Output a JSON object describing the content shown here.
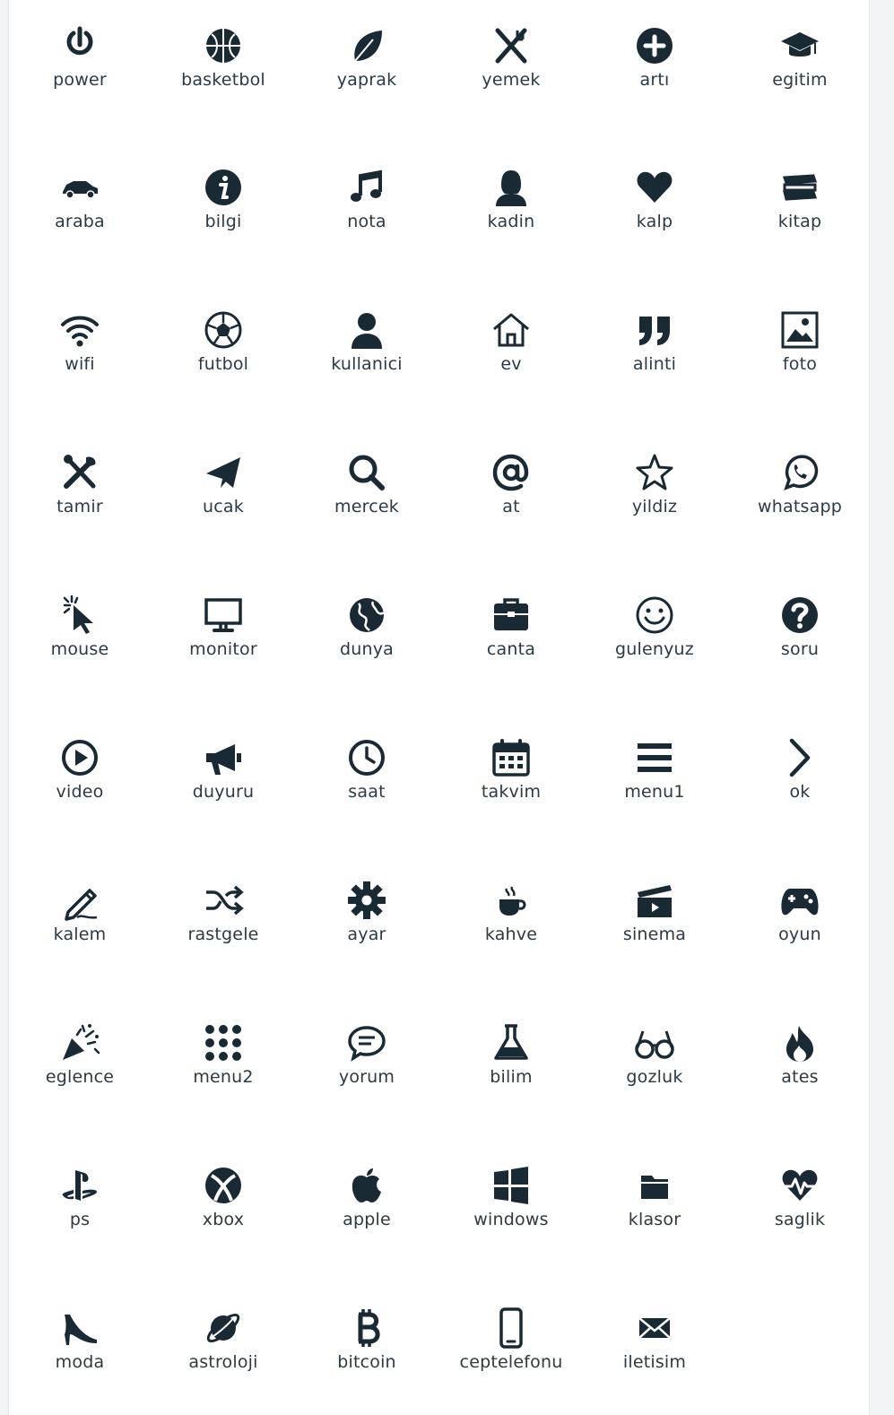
{
  "colors": {
    "icon": "#1a2a35",
    "label": "#2b3a44",
    "background": "#ffffff"
  },
  "icons": [
    {
      "label": "power",
      "icon": "power-icon"
    },
    {
      "label": "basketbol",
      "icon": "basketball-icon"
    },
    {
      "label": "yaprak",
      "icon": "leaf-icon"
    },
    {
      "label": "yemek",
      "icon": "utensils-icon"
    },
    {
      "label": "artı",
      "icon": "plus-circle-icon"
    },
    {
      "label": "egitim",
      "icon": "graduation-cap-icon"
    },
    {
      "label": "araba",
      "icon": "car-icon"
    },
    {
      "label": "bilgi",
      "icon": "info-icon"
    },
    {
      "label": "nota",
      "icon": "music-note-icon"
    },
    {
      "label": "kadin",
      "icon": "woman-icon"
    },
    {
      "label": "kalp",
      "icon": "heart-icon"
    },
    {
      "label": "kitap",
      "icon": "books-icon"
    },
    {
      "label": "wifi",
      "icon": "wifi-icon"
    },
    {
      "label": "futbol",
      "icon": "soccer-ball-icon"
    },
    {
      "label": "kullanici",
      "icon": "user-icon"
    },
    {
      "label": "ev",
      "icon": "home-icon"
    },
    {
      "label": "alinti",
      "icon": "quote-icon"
    },
    {
      "label": "foto",
      "icon": "photo-icon"
    },
    {
      "label": "tamir",
      "icon": "tools-icon"
    },
    {
      "label": "ucak",
      "icon": "paper-plane-icon"
    },
    {
      "label": "mercek",
      "icon": "search-icon"
    },
    {
      "label": "at",
      "icon": "at-sign-icon"
    },
    {
      "label": "yildiz",
      "icon": "star-icon"
    },
    {
      "label": "whatsapp",
      "icon": "whatsapp-icon"
    },
    {
      "label": "mouse",
      "icon": "cursor-icon"
    },
    {
      "label": "monitor",
      "icon": "monitor-icon"
    },
    {
      "label": "dunya",
      "icon": "globe-icon"
    },
    {
      "label": "canta",
      "icon": "briefcase-icon"
    },
    {
      "label": "gulenyuz",
      "icon": "smiley-icon"
    },
    {
      "label": "soru",
      "icon": "question-icon"
    },
    {
      "label": "video",
      "icon": "play-circle-icon"
    },
    {
      "label": "duyuru",
      "icon": "megaphone-icon"
    },
    {
      "label": "saat",
      "icon": "clock-icon"
    },
    {
      "label": "takvim",
      "icon": "calendar-icon"
    },
    {
      "label": "menu1",
      "icon": "hamburger-icon"
    },
    {
      "label": "ok",
      "icon": "chevron-right-icon"
    },
    {
      "label": "kalem",
      "icon": "pencil-icon"
    },
    {
      "label": "rastgele",
      "icon": "shuffle-icon"
    },
    {
      "label": "ayar",
      "icon": "gear-icon"
    },
    {
      "label": "kahve",
      "icon": "coffee-icon"
    },
    {
      "label": "sinema",
      "icon": "clapperboard-icon"
    },
    {
      "label": "oyun",
      "icon": "gamepad-icon"
    },
    {
      "label": "eglence",
      "icon": "party-popper-icon"
    },
    {
      "label": "menu2",
      "icon": "dots-grid-icon"
    },
    {
      "label": "yorum",
      "icon": "comment-icon"
    },
    {
      "label": "bilim",
      "icon": "flask-icon"
    },
    {
      "label": "gozluk",
      "icon": "glasses-icon"
    },
    {
      "label": "ates",
      "icon": "fire-icon"
    },
    {
      "label": "ps",
      "icon": "playstation-icon"
    },
    {
      "label": "xbox",
      "icon": "xbox-icon"
    },
    {
      "label": "apple",
      "icon": "apple-icon"
    },
    {
      "label": "windows",
      "icon": "windows-icon"
    },
    {
      "label": "klasor",
      "icon": "folder-icon"
    },
    {
      "label": "saglik",
      "icon": "heartbeat-icon"
    },
    {
      "label": "moda",
      "icon": "high-heel-icon"
    },
    {
      "label": "astroloji",
      "icon": "planet-icon"
    },
    {
      "label": "bitcoin",
      "icon": "bitcoin-icon"
    },
    {
      "label": "ceptelefonu",
      "icon": "mobile-phone-icon"
    },
    {
      "label": "iletisim",
      "icon": "envelope-icon"
    }
  ]
}
